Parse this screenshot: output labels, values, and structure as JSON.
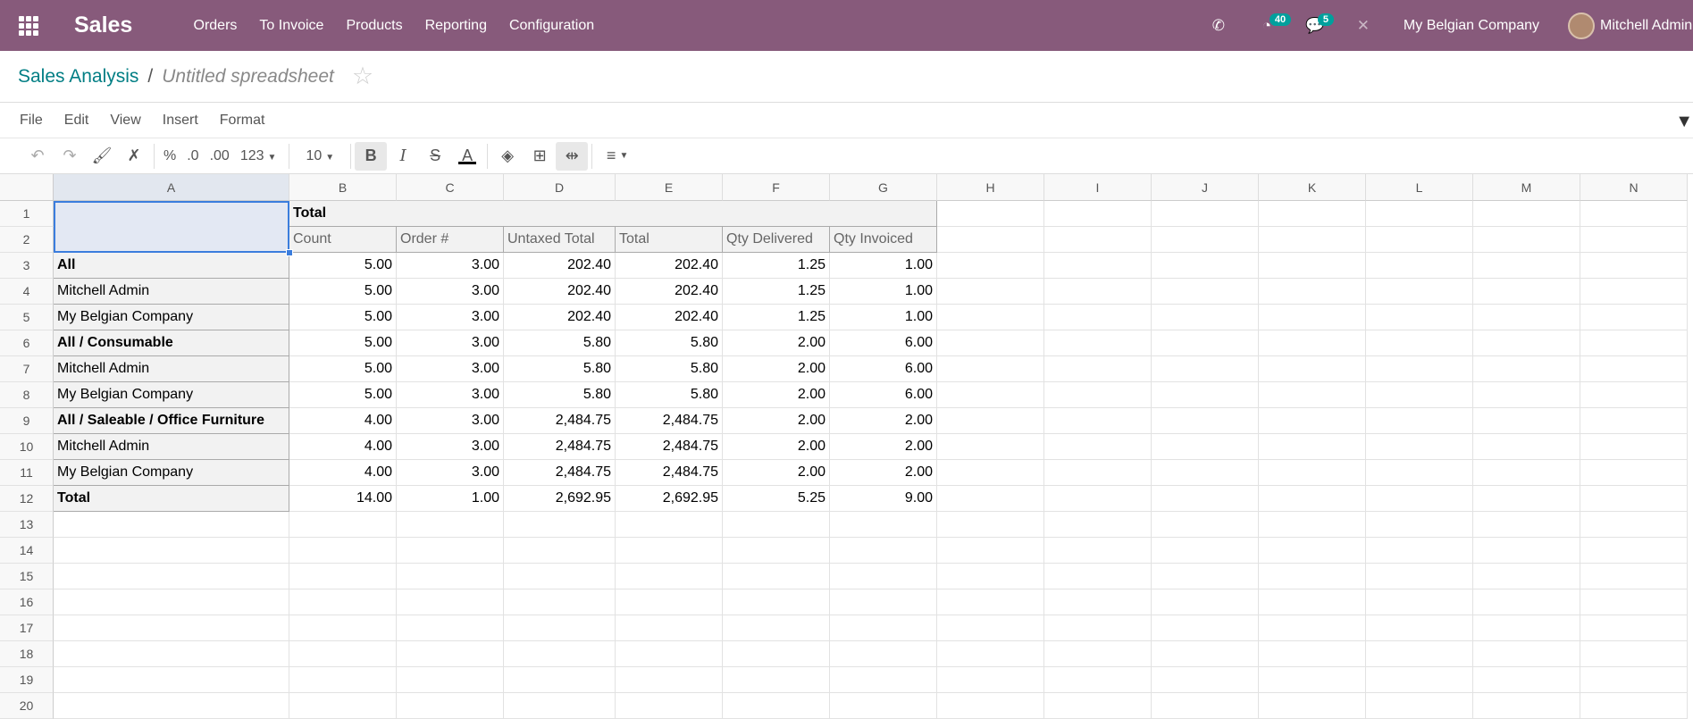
{
  "navbar": {
    "app_name": "Sales",
    "menu": [
      "Orders",
      "To Invoice",
      "Products",
      "Reporting",
      "Configuration"
    ],
    "activity_count": "40",
    "message_count": "5",
    "company": "My Belgian Company",
    "user": "Mitchell Admin"
  },
  "breadcrumb": {
    "parent": "Sales Analysis",
    "separator": "/",
    "current": "Untitled spreadsheet"
  },
  "sheet_menu": [
    "File",
    "Edit",
    "View",
    "Insert",
    "Format"
  ],
  "toolbar": {
    "percent": "%",
    "dec_decimals": ".0",
    "inc_decimals": ".00",
    "more_formats": "123",
    "font_size": "10"
  },
  "columns": [
    "A",
    "B",
    "C",
    "D",
    "E",
    "F",
    "G",
    "H",
    "I",
    "J",
    "K",
    "L",
    "M",
    "N"
  ],
  "rows": [
    "1",
    "2",
    "3",
    "4",
    "5",
    "6",
    "7",
    "8",
    "9",
    "10",
    "11",
    "12",
    "13",
    "14",
    "15",
    "16",
    "17",
    "18",
    "19",
    "20"
  ],
  "pivot": {
    "top_header": "Total",
    "measures": [
      "Count",
      "Order #",
      "Untaxed Total",
      "Total",
      "Qty Delivered",
      "Qty Invoiced"
    ],
    "body": [
      {
        "label": "All",
        "bold": true,
        "values": [
          "5.00",
          "3.00",
          "202.40",
          "202.40",
          "1.25",
          "1.00"
        ]
      },
      {
        "label": "Mitchell Admin",
        "bold": false,
        "values": [
          "5.00",
          "3.00",
          "202.40",
          "202.40",
          "1.25",
          "1.00"
        ]
      },
      {
        "label": "My Belgian Company",
        "bold": false,
        "values": [
          "5.00",
          "3.00",
          "202.40",
          "202.40",
          "1.25",
          "1.00"
        ]
      },
      {
        "label": "All / Consumable",
        "bold": true,
        "values": [
          "5.00",
          "3.00",
          "5.80",
          "5.80",
          "2.00",
          "6.00"
        ]
      },
      {
        "label": "Mitchell Admin",
        "bold": false,
        "values": [
          "5.00",
          "3.00",
          "5.80",
          "5.80",
          "2.00",
          "6.00"
        ]
      },
      {
        "label": "My Belgian Company",
        "bold": false,
        "values": [
          "5.00",
          "3.00",
          "5.80",
          "5.80",
          "2.00",
          "6.00"
        ]
      },
      {
        "label": "All / Saleable / Office Furniture",
        "bold": true,
        "values": [
          "4.00",
          "3.00",
          "2,484.75",
          "2,484.75",
          "2.00",
          "2.00"
        ]
      },
      {
        "label": "Mitchell Admin",
        "bold": false,
        "values": [
          "4.00",
          "3.00",
          "2,484.75",
          "2,484.75",
          "2.00",
          "2.00"
        ]
      },
      {
        "label": "My Belgian Company",
        "bold": false,
        "values": [
          "4.00",
          "3.00",
          "2,484.75",
          "2,484.75",
          "2.00",
          "2.00"
        ]
      },
      {
        "label": "Total",
        "bold": true,
        "values": [
          "14.00",
          "1.00",
          "2,692.95",
          "2,692.95",
          "5.25",
          "9.00"
        ]
      }
    ]
  }
}
